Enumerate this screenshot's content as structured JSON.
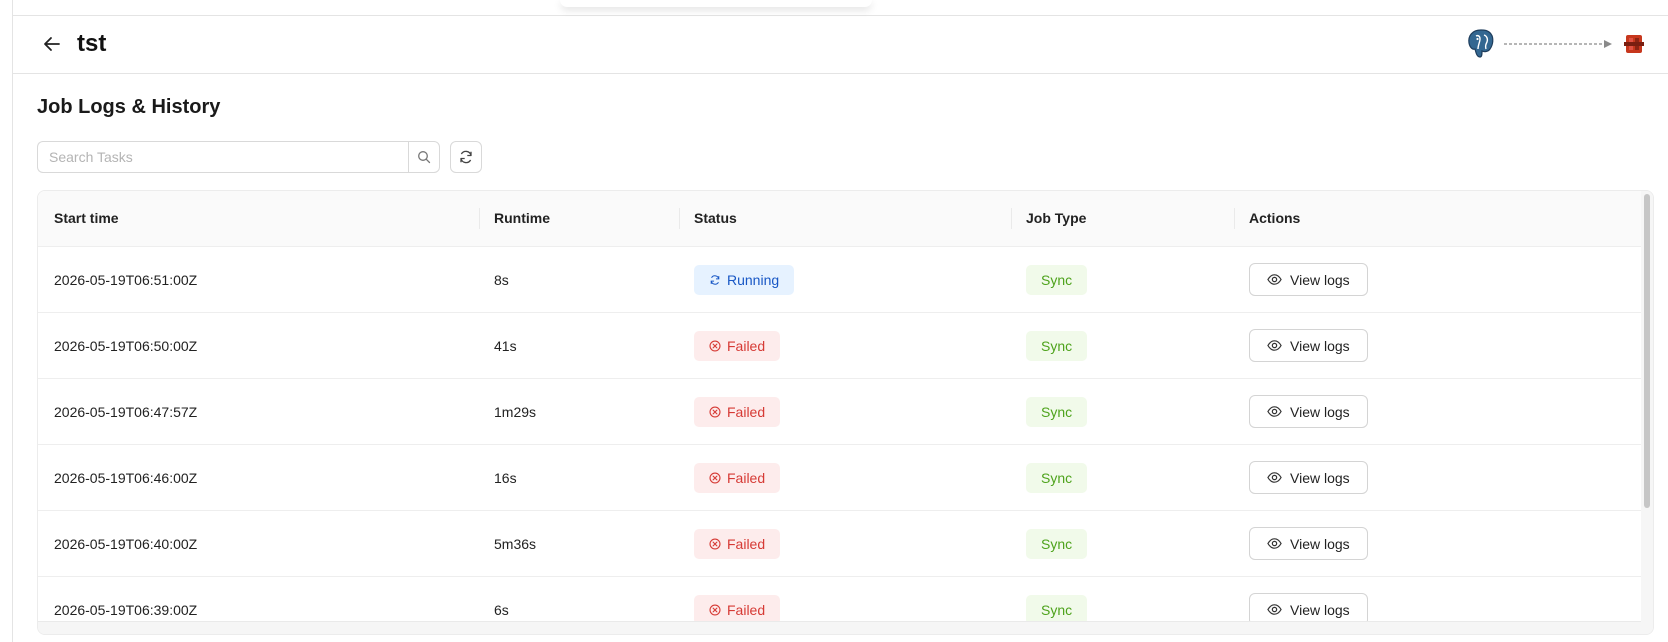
{
  "header": {
    "title": "tst",
    "source_icon": "postgres-elephant-icon",
    "destination_icon": "aws-s3-icon"
  },
  "section": {
    "title": "Job Logs & History"
  },
  "search": {
    "placeholder": "Search Tasks",
    "value": ""
  },
  "table": {
    "columns": [
      "Start time",
      "Runtime",
      "Status",
      "Job Type",
      "Actions"
    ],
    "rows": [
      {
        "start_time": "2026-05-19T06:51:00Z",
        "runtime": "8s",
        "status": "Running",
        "job_type": "Sync",
        "action": "View logs"
      },
      {
        "start_time": "2026-05-19T06:50:00Z",
        "runtime": "41s",
        "status": "Failed",
        "job_type": "Sync",
        "action": "View logs"
      },
      {
        "start_time": "2026-05-19T06:47:57Z",
        "runtime": "1m29s",
        "status": "Failed",
        "job_type": "Sync",
        "action": "View logs"
      },
      {
        "start_time": "2026-05-19T06:46:00Z",
        "runtime": "16s",
        "status": "Failed",
        "job_type": "Sync",
        "action": "View logs"
      },
      {
        "start_time": "2026-05-19T06:40:00Z",
        "runtime": "5m36s",
        "status": "Failed",
        "job_type": "Sync",
        "action": "View logs"
      },
      {
        "start_time": "2026-05-19T06:39:00Z",
        "runtime": "6s",
        "status": "Failed",
        "job_type": "Sync",
        "action": "View logs"
      }
    ]
  },
  "colors": {
    "running_bg": "#e6f2ff",
    "running_text": "#1857c5",
    "failed_bg": "#fdecec",
    "failed_text": "#d63a35",
    "sync_bg": "#f1faea",
    "sync_text": "#4ea31c"
  }
}
